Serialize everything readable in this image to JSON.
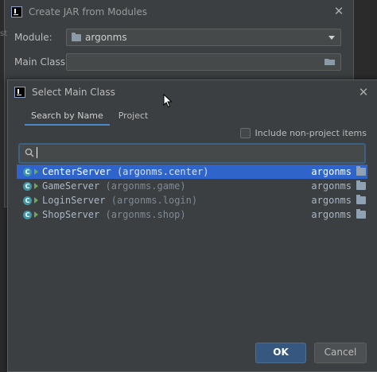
{
  "background_dialog": {
    "title": "Create JAR from Modules",
    "edge_text": "st",
    "module_label": "Module:",
    "module_value": "argonms",
    "main_class_label": "Main Class:",
    "main_class_value": ""
  },
  "select_dialog": {
    "title": "Select Main Class",
    "tabs": [
      {
        "label": "Search by Name",
        "active": true
      },
      {
        "label": "Project",
        "active": false
      }
    ],
    "include_non_project_label": "Include non-project items",
    "include_non_project_checked": false,
    "search_value": "",
    "results": [
      {
        "name": "CenterServer",
        "package": "(argonms.center)",
        "module": "argonms",
        "selected": true
      },
      {
        "name": "GameServer",
        "package": "(argonms.game)",
        "module": "argonms",
        "selected": false
      },
      {
        "name": "LoginServer",
        "package": "(argonms.login)",
        "module": "argonms",
        "selected": false
      },
      {
        "name": "ShopServer",
        "package": "(argonms.shop)",
        "module": "argonms",
        "selected": false
      }
    ],
    "class_icon_letter": "C",
    "ok_label": "OK",
    "cancel_label": "Cancel"
  },
  "icons": {
    "app": "intellij-icon",
    "close": "close-icon",
    "folder": "module-folder-icon",
    "search": "search-icon",
    "class": "java-class-icon",
    "run": "run-mark-icon"
  },
  "colors": {
    "accent": "#2f65ca",
    "ok_button": "#365880",
    "dialog_bg": "#3c3f41"
  }
}
